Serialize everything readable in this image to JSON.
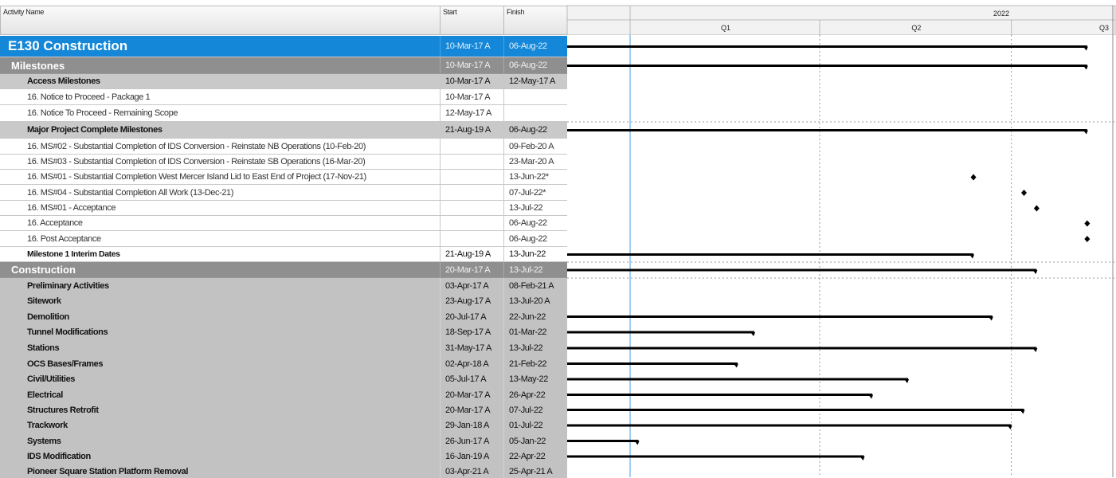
{
  "columns": {
    "name": "Activity Name",
    "start": "Start",
    "finish": "Finish"
  },
  "timeline": {
    "year": "2022",
    "quarters": [
      "Q1",
      "Q2",
      "Q3"
    ],
    "colors": {
      "header_blue": "#1487d8",
      "group_gray": "#8f8f8f",
      "subgroup_gray": "#c9c9c9",
      "bar": "#000000",
      "today_line": "#66aee8"
    }
  },
  "rows": [
    {
      "name": "E130 Construction",
      "start": "10-Mar-17 A",
      "finish": "06-Aug-22",
      "level": "lvl0",
      "mark": "bar",
      "to": "2022-08-06"
    },
    {
      "name": "Milestones",
      "start": "10-Mar-17 A",
      "finish": "06-Aug-22",
      "level": "lvl1",
      "mark": "bar",
      "to": "2022-08-06"
    },
    {
      "name": "Access Milestones",
      "start": "10-Mar-17 A",
      "finish": "12-May-17 A",
      "level": "lvl2",
      "mark": "none"
    },
    {
      "name": "16. Notice to Proceed - Package 1",
      "start": "10-Mar-17 A",
      "finish": "",
      "level": "act",
      "mark": "none"
    },
    {
      "name": "16. Notice To Proceed - Remaining Scope",
      "start": "12-May-17 A",
      "finish": "",
      "level": "act",
      "mark": "none"
    },
    {
      "name": "Major Project Complete Milestones",
      "start": "21-Aug-19 A",
      "finish": "06-Aug-22",
      "level": "lvl2",
      "mark": "bar",
      "to": "2022-08-06"
    },
    {
      "name": "16. MS#02 - Substantial Completion of IDS Conversion - Reinstate NB Operations (10-Feb-20)",
      "start": "",
      "finish": "09-Feb-20 A",
      "level": "act",
      "mark": "none"
    },
    {
      "name": "16. MS#03 - Substantial Completion of IDS Conversion - Reinstate SB Operations (16-Mar-20)",
      "start": "",
      "finish": "23-Mar-20 A",
      "level": "act",
      "mark": "none"
    },
    {
      "name": "16. MS#01 - Substantial Completion West Mercer Island Lid to East End of Project (17-Nov-21)",
      "start": "",
      "finish": "13-Jun-22*",
      "level": "act",
      "mark": "diamond",
      "to": "2022-06-13"
    },
    {
      "name": "16. MS#04 - Substantial Completion All Work (13-Dec-21)",
      "start": "",
      "finish": "07-Jul-22*",
      "level": "act",
      "mark": "diamond",
      "to": "2022-07-07"
    },
    {
      "name": "16. MS#01 - Acceptance",
      "start": "",
      "finish": "13-Jul-22",
      "level": "act",
      "mark": "diamond",
      "to": "2022-07-13"
    },
    {
      "name": "16. Acceptance",
      "start": "",
      "finish": "06-Aug-22",
      "level": "act",
      "mark": "diamond",
      "to": "2022-08-06"
    },
    {
      "name": "16. Post Acceptance",
      "start": "",
      "finish": "06-Aug-22",
      "level": "act",
      "mark": "diamond",
      "to": "2022-08-06"
    },
    {
      "name": "Milestone 1 Interim Dates",
      "start": "21-Aug-19 A",
      "finish": "13-Jun-22",
      "level": "sub",
      "mark": "bar",
      "to": "2022-06-13"
    },
    {
      "name": "Construction",
      "start": "20-Mar-17 A",
      "finish": "13-Jul-22",
      "level": "lvl1",
      "mark": "bar",
      "to": "2022-07-13"
    },
    {
      "name": "Preliminary Activities",
      "start": "03-Apr-17 A",
      "finish": "08-Feb-21 A",
      "level": "con",
      "mark": "none"
    },
    {
      "name": "Sitework",
      "start": "23-Aug-17 A",
      "finish": "13-Jul-20 A",
      "level": "con",
      "mark": "none"
    },
    {
      "name": "Demolition",
      "start": "20-Jul-17 A",
      "finish": "22-Jun-22",
      "level": "con",
      "mark": "bar",
      "to": "2022-06-22"
    },
    {
      "name": "Tunnel Modifications",
      "start": "18-Sep-17 A",
      "finish": "01-Mar-22",
      "level": "con",
      "mark": "bar",
      "to": "2022-03-01"
    },
    {
      "name": "Stations",
      "start": "31-May-17 A",
      "finish": "13-Jul-22",
      "level": "con",
      "mark": "bar",
      "to": "2022-07-13"
    },
    {
      "name": "OCS Bases/Frames",
      "start": "02-Apr-18 A",
      "finish": "21-Feb-22",
      "level": "con",
      "mark": "bar",
      "to": "2022-02-21"
    },
    {
      "name": "Civil/Utilities",
      "start": "05-Jul-17 A",
      "finish": "13-May-22",
      "level": "con",
      "mark": "bar",
      "to": "2022-05-13"
    },
    {
      "name": "Electrical",
      "start": "20-Mar-17 A",
      "finish": "26-Apr-22",
      "level": "con",
      "mark": "bar",
      "to": "2022-04-26"
    },
    {
      "name": "Structures Retrofit",
      "start": "20-Mar-17 A",
      "finish": "07-Jul-22",
      "level": "con",
      "mark": "bar",
      "to": "2022-07-07"
    },
    {
      "name": "Trackwork",
      "start": "29-Jan-18 A",
      "finish": "01-Jul-22",
      "level": "con",
      "mark": "bar",
      "to": "2022-07-01"
    },
    {
      "name": "Systems",
      "start": "26-Jun-17 A",
      "finish": "05-Jan-22",
      "level": "con",
      "mark": "bar",
      "to": "2022-01-05"
    },
    {
      "name": "IDS Modification",
      "start": "16-Jan-19 A",
      "finish": "22-Apr-22",
      "level": "con",
      "mark": "bar",
      "to": "2022-04-22"
    },
    {
      "name": "Pioneer Square Station Platform Removal",
      "start": "03-Apr-21 A",
      "finish": "25-Apr-21 A",
      "level": "con",
      "mark": "none"
    }
  ]
}
